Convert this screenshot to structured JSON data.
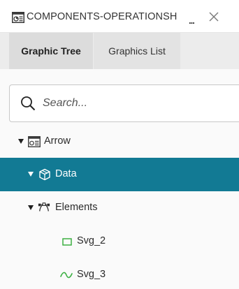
{
  "header": {
    "title": "COMPONENTS-OPERATIONSH",
    "ellipsis": "...",
    "document_icon": "dashboard-document-icon",
    "close_icon": "close-icon"
  },
  "tabs": [
    {
      "label": "Graphic Tree",
      "active": true
    },
    {
      "label": "Graphics List",
      "active": false
    }
  ],
  "search": {
    "placeholder": "Search...",
    "value": "",
    "icon": "search-icon"
  },
  "tree": [
    {
      "label": "Arrow",
      "icon": "window-icon",
      "expanded": true,
      "selected": false,
      "level": 0
    },
    {
      "label": "Data",
      "icon": "cube-icon",
      "expanded": true,
      "selected": true,
      "level": 1
    },
    {
      "label": "Elements",
      "icon": "vector-nodes-icon",
      "expanded": true,
      "selected": false,
      "level": 1
    },
    {
      "label": "Svg_2",
      "icon": "rectangle-shape-icon",
      "selected": false,
      "level": 2
    },
    {
      "label": "Svg_3",
      "icon": "wave-line-icon",
      "selected": false,
      "level": 2
    }
  ],
  "colors": {
    "selected_row": "#127a94",
    "shape_icon_green": "#3cb043",
    "tab_bar": "#ececec"
  }
}
